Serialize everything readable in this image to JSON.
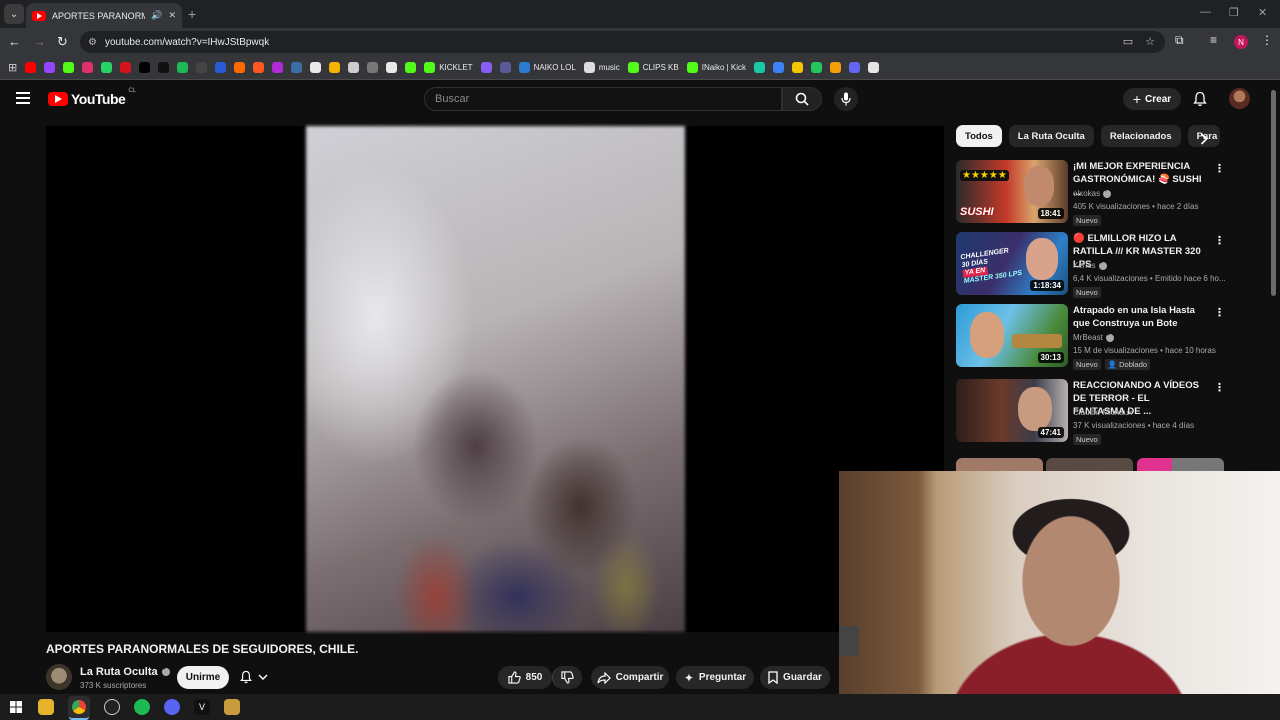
{
  "browser": {
    "tab_title": "APORTES PARANORMALES DE SEGUIDORES",
    "url": "youtube.com/watch?v=IHwJStBpwqk",
    "profile_initial": "N",
    "bookmarks": [
      {
        "label": "",
        "color": "#ff0000"
      },
      {
        "label": "",
        "color": "#9146ff"
      },
      {
        "label": "",
        "color": "#53fc18"
      },
      {
        "label": "",
        "color": "#e1306c"
      },
      {
        "label": "",
        "color": "#25d366"
      },
      {
        "label": "",
        "color": "#d6121b"
      },
      {
        "label": "",
        "color": "#000000"
      },
      {
        "label": "",
        "color": "#111111"
      },
      {
        "label": "",
        "color": "#1db954"
      },
      {
        "label": "",
        "color": "#444444"
      },
      {
        "label": "",
        "color": "#2a5bd7"
      },
      {
        "label": "",
        "color": "#ff6a00"
      },
      {
        "label": "",
        "color": "#ff5722"
      },
      {
        "label": "",
        "color": "#b02ad7"
      },
      {
        "label": "",
        "color": "#3a6ea5"
      },
      {
        "label": "",
        "color": "#e8e8e8"
      },
      {
        "label": "",
        "color": "#f5b400"
      },
      {
        "label": "",
        "color": "#cccccc"
      },
      {
        "label": "",
        "color": "#777777"
      },
      {
        "label": "",
        "color": "#e8e8e8"
      },
      {
        "label": "",
        "color": "#53fc18"
      },
      {
        "label": "KICKLET",
        "color": "#53fc18"
      },
      {
        "label": "",
        "color": "#8a5cf6"
      },
      {
        "label": "",
        "color": "#5a5a9a"
      },
      {
        "label": "NAIKO LOL",
        "color": "#2b7bd1"
      },
      {
        "label": "music",
        "color": "#dddddd"
      },
      {
        "label": "CLIPS KB",
        "color": "#53fc18"
      },
      {
        "label": "INaiko | Kick",
        "color": "#53fc18"
      },
      {
        "label": "",
        "color": "#1ac8a8"
      },
      {
        "label": "",
        "color": "#3b82f6"
      },
      {
        "label": "",
        "color": "#f5c400"
      },
      {
        "label": "",
        "color": "#22c55e"
      },
      {
        "label": "",
        "color": "#f59e0b"
      },
      {
        "label": "",
        "color": "#6366f1"
      },
      {
        "label": "",
        "color": "#e5e5e5"
      }
    ]
  },
  "youtube": {
    "logo_text": "YouTube",
    "country_code": "CL",
    "search_placeholder": "Buscar",
    "create_label": "Crear",
    "video_title": "APORTES PARANORMALES DE SEGUIDORES, CHILE.",
    "channel": {
      "name": "La Ruta Oculta",
      "subscribers": "373 K suscriptores",
      "join_label": "Unirme"
    },
    "actions": {
      "likes": "850",
      "share": "Compartir",
      "ask": "Preguntar",
      "save": "Guardar"
    },
    "chips": [
      "Todos",
      "La Ruta Oculta",
      "Relacionados",
      "Para"
    ],
    "recommendations": [
      {
        "title": "¡MI MEJOR EXPERIENCIA GASTRONÓMICA! 🍣 SUSHI ...",
        "channel": "elxokas",
        "meta": "405 K visualizaciones • hace 2 días",
        "duration": "18:41",
        "badges": [
          "Nuevo"
        ]
      },
      {
        "title": "🔴 ELMILLOR HIZO LA RATILLA /// KR MASTER 320 LPS",
        "channel": "Kerios",
        "meta": "6,4 K visualizaciones • Emitido hace 6 ho...",
        "duration": "1:18:34",
        "badges": [
          "Nuevo"
        ]
      },
      {
        "title": "Atrapado en una Isla Hasta que Construya un Bote",
        "channel": "MrBeast",
        "meta": "15 M de visualizaciones • hace 10 horas",
        "duration": "30:13",
        "badges": [
          "Nuevo",
          "Doblado"
        ]
      },
      {
        "title": "REACCIONANDO A VÍDEOS DE TERROR - EL FANTASMA DE ...",
        "channel": "Claudio Michaux",
        "meta": "37 K visualizaciones • hace 4 días",
        "duration": "47:41",
        "badges": [
          "Nuevo"
        ]
      }
    ]
  },
  "thumb_text": {
    "sushi": "SUSHI",
    "challenger_1": "CHALLENGER",
    "challenger_2": "30 DÍAS",
    "challenger_3": "YA EN",
    "challenger_4": "MASTER 350 LPS"
  }
}
